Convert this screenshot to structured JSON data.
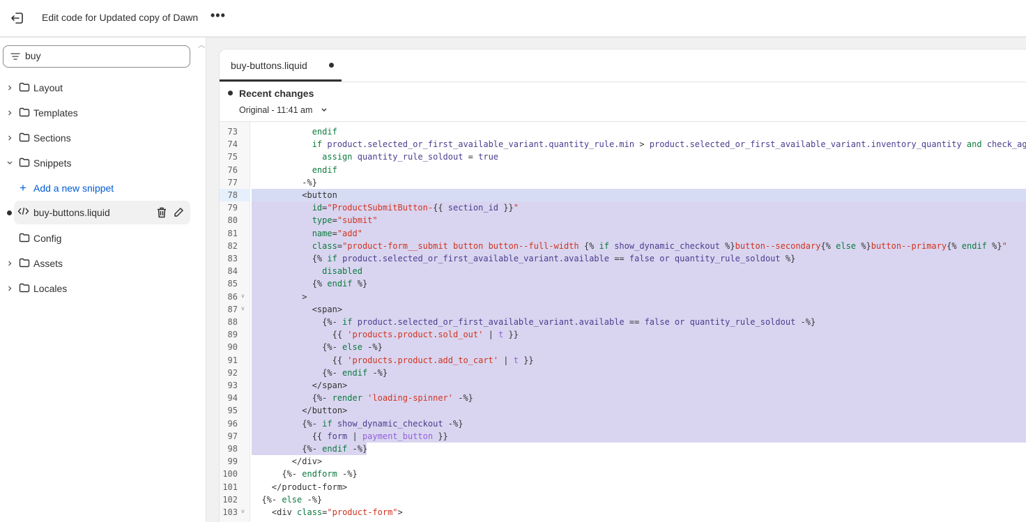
{
  "header": {
    "title": "Edit code for Updated copy of Dawn",
    "more_label": "•••"
  },
  "sidebar": {
    "search_value": "buy",
    "items": [
      {
        "label": "Layout",
        "type": "folder",
        "expandable": true
      },
      {
        "label": "Templates",
        "type": "folder",
        "expandable": true
      },
      {
        "label": "Sections",
        "type": "folder",
        "expandable": true
      },
      {
        "label": "Snippets",
        "type": "folder",
        "expanded": true
      },
      {
        "label": "Add a new snippet",
        "type": "add"
      },
      {
        "label": "buy-buttons.liquid",
        "type": "file",
        "active": true,
        "modified": true
      },
      {
        "label": "Config",
        "type": "folder",
        "expandable": false
      },
      {
        "label": "Assets",
        "type": "folder",
        "expandable": true
      },
      {
        "label": "Locales",
        "type": "folder",
        "expandable": true
      }
    ]
  },
  "editor": {
    "tab_label": "buy-buttons.liquid",
    "recent_changes_label": "Recent changes",
    "version_label": "Original - 11:41 am",
    "colors": {
      "keyword": "#0b7a3e",
      "string": "#d1331f",
      "variable": "#4b3d8f",
      "filter": "#9460d9",
      "selection": "#d9d5f0"
    },
    "lines": [
      {
        "n": "73",
        "t": [
          [
            "k",
            "            endif"
          ]
        ]
      },
      {
        "n": "74",
        "t": [
          [
            "k",
            "            if"
          ],
          [
            "v",
            " product.selected_or_first_available_variant.quantity_rule.min"
          ],
          [
            "p",
            " >"
          ],
          [
            "v",
            " product.selected_or_first_available_variant.inventory_quantity"
          ],
          [
            "k",
            " and"
          ],
          [
            "v",
            " check_against_inventory"
          ]
        ]
      },
      {
        "n": "75",
        "t": [
          [
            "k",
            "              assign"
          ],
          [
            "v",
            " quantity_rule_soldout"
          ],
          [
            "p",
            " ="
          ],
          [
            "v",
            " true"
          ]
        ]
      },
      {
        "n": "76",
        "t": [
          [
            "k",
            "            endif"
          ]
        ]
      },
      {
        "n": "77",
        "t": [
          [
            "p",
            "          -%}"
          ]
        ]
      },
      {
        "n": "78",
        "t": [
          [
            "p",
            "          <button"
          ]
        ]
      },
      {
        "n": "79",
        "t": [
          [
            "k",
            "            id"
          ],
          [
            "p",
            "="
          ],
          [
            "s",
            "\"ProductSubmitButton-"
          ],
          [
            "p",
            "{{"
          ],
          [
            "v",
            " section_id"
          ],
          [
            "p",
            " }}"
          ],
          [
            "s",
            "\""
          ]
        ]
      },
      {
        "n": "80",
        "t": [
          [
            "k",
            "            type"
          ],
          [
            "p",
            "="
          ],
          [
            "s",
            "\"submit\""
          ]
        ]
      },
      {
        "n": "81",
        "t": [
          [
            "k",
            "            name"
          ],
          [
            "p",
            "="
          ],
          [
            "s",
            "\"add\""
          ]
        ]
      },
      {
        "n": "82",
        "t": [
          [
            "k",
            "            class"
          ],
          [
            "p",
            "="
          ],
          [
            "s",
            "\"product-form__submit button button--full-width "
          ],
          [
            "p",
            "{%"
          ],
          [
            "k",
            " if"
          ],
          [
            "v",
            " show_dynamic_checkout"
          ],
          [
            "p",
            " %}"
          ],
          [
            "s",
            "button--secondary"
          ],
          [
            "p",
            "{%"
          ],
          [
            "k",
            " else"
          ],
          [
            "p",
            " %}"
          ],
          [
            "s",
            "button--primary"
          ],
          [
            "p",
            "{%"
          ],
          [
            "k",
            " endif"
          ],
          [
            "p",
            " %}"
          ],
          [
            "s",
            "\""
          ]
        ]
      },
      {
        "n": "83",
        "t": [
          [
            "p",
            "            {%"
          ],
          [
            "k",
            " if"
          ],
          [
            "v",
            " product.selected_or_first_available_variant.available"
          ],
          [
            "p",
            " =="
          ],
          [
            "v",
            " false or quantity_rule_soldout"
          ],
          [
            "p",
            " %}"
          ]
        ]
      },
      {
        "n": "84",
        "t": [
          [
            "k",
            "              disabled"
          ]
        ]
      },
      {
        "n": "85",
        "t": [
          [
            "p",
            "            {%"
          ],
          [
            "k",
            " endif"
          ],
          [
            "p",
            " %}"
          ]
        ]
      },
      {
        "n": "86",
        "fold": true,
        "t": [
          [
            "p",
            "          >"
          ]
        ]
      },
      {
        "n": "87",
        "fold": true,
        "t": [
          [
            "p",
            "            <span>"
          ]
        ]
      },
      {
        "n": "88",
        "t": [
          [
            "p",
            "              {%-"
          ],
          [
            "k",
            " if"
          ],
          [
            "v",
            " product.selected_or_first_available_variant.available"
          ],
          [
            "p",
            " =="
          ],
          [
            "v",
            " false or quantity_rule_soldout"
          ],
          [
            "p",
            " -%}"
          ]
        ]
      },
      {
        "n": "89",
        "t": [
          [
            "p",
            "                {{"
          ],
          [
            "s",
            " 'products.product.sold_out'"
          ],
          [
            "p",
            " |"
          ],
          [
            "f",
            " t"
          ],
          [
            "p",
            " }}"
          ]
        ]
      },
      {
        "n": "90",
        "t": [
          [
            "p",
            "              {%-"
          ],
          [
            "k",
            " else"
          ],
          [
            "p",
            " -%}"
          ]
        ]
      },
      {
        "n": "91",
        "t": [
          [
            "p",
            "                {{"
          ],
          [
            "s",
            " 'products.product.add_to_cart'"
          ],
          [
            "p",
            " |"
          ],
          [
            "f",
            " t"
          ],
          [
            "p",
            " }}"
          ]
        ]
      },
      {
        "n": "92",
        "t": [
          [
            "p",
            "              {%-"
          ],
          [
            "k",
            " endif"
          ],
          [
            "p",
            " -%}"
          ]
        ]
      },
      {
        "n": "93",
        "t": [
          [
            "p",
            "            </span>"
          ]
        ]
      },
      {
        "n": "94",
        "t": [
          [
            "p",
            "            {%-"
          ],
          [
            "k",
            " render"
          ],
          [
            "s",
            " 'loading-spinner'"
          ],
          [
            "p",
            " -%}"
          ]
        ]
      },
      {
        "n": "95",
        "t": [
          [
            "p",
            "          </button>"
          ]
        ]
      },
      {
        "n": "96",
        "t": [
          [
            "p",
            "          {%-"
          ],
          [
            "k",
            " if"
          ],
          [
            "v",
            " show_dynamic_checkout"
          ],
          [
            "p",
            " -%}"
          ]
        ]
      },
      {
        "n": "97",
        "t": [
          [
            "p",
            "            {{"
          ],
          [
            "v",
            " form"
          ],
          [
            "p",
            " |"
          ],
          [
            "f",
            " payment_button"
          ],
          [
            "p",
            " }}"
          ]
        ]
      },
      {
        "n": "98",
        "t": [
          [
            "p",
            "          {%-"
          ],
          [
            "k",
            " endif"
          ],
          [
            "p",
            " -%}"
          ]
        ]
      },
      {
        "n": "99",
        "t": [
          [
            "p",
            "        </div>"
          ]
        ]
      },
      {
        "n": "100",
        "t": [
          [
            "p",
            "      {%-"
          ],
          [
            "k",
            " endform"
          ],
          [
            "p",
            " -%}"
          ]
        ]
      },
      {
        "n": "101",
        "t": [
          [
            "p",
            "    </product-form>"
          ]
        ]
      },
      {
        "n": "102",
        "t": [
          [
            "p",
            "  {%-"
          ],
          [
            "k",
            " else"
          ],
          [
            "p",
            " -%}"
          ]
        ]
      },
      {
        "n": "103",
        "fold": true,
        "t": [
          [
            "p",
            "    <div "
          ],
          [
            "k",
            "class"
          ],
          [
            "p",
            "="
          ],
          [
            "s",
            "\"product-form\""
          ],
          [
            "p",
            ">"
          ]
        ]
      }
    ]
  }
}
